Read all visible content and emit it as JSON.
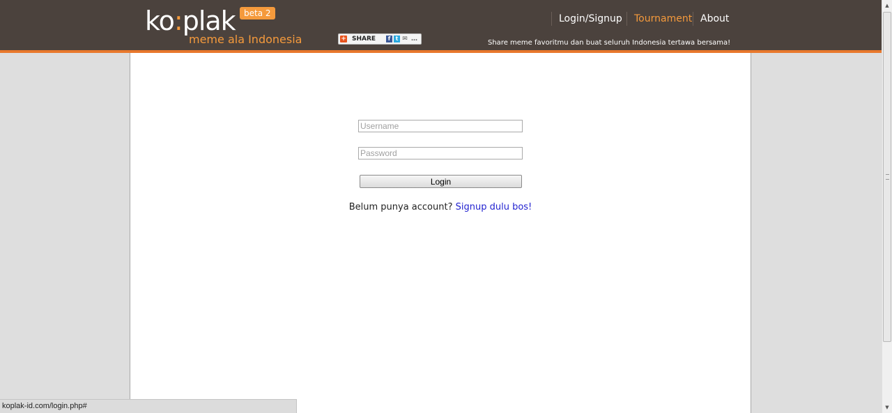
{
  "header": {
    "logo_text_1": "ko",
    "logo_colon": ":",
    "logo_text_2": "plak",
    "beta_label": "beta 2",
    "subtitle": "meme ala Indonesia",
    "share_label": "SHARE",
    "nav": {
      "login_signup": "Login/Signup",
      "tournament": "Tournament",
      "about": "About"
    },
    "tagline": "Share meme favoritmu dan buat seluruh Indonesia tertawa bersama!"
  },
  "form": {
    "username_placeholder": "Username",
    "username_value": "",
    "password_placeholder": "Password",
    "password_value": "",
    "login_label": "Login",
    "signup_prompt": "Belum punya account?",
    "signup_link": "Signup dulu bos!"
  },
  "status_bar": {
    "url": "koplak-id.com/login.php#"
  },
  "colors": {
    "header_bg": "#4b423d",
    "accent": "#f59a3c",
    "accent_border": "#e8782c",
    "link": "#2323d0"
  },
  "icons": [
    "addthis-plus-icon",
    "facebook-icon",
    "twitter-icon",
    "email-icon",
    "scroll-up-arrow-icon",
    "scroll-down-arrow-icon"
  ]
}
